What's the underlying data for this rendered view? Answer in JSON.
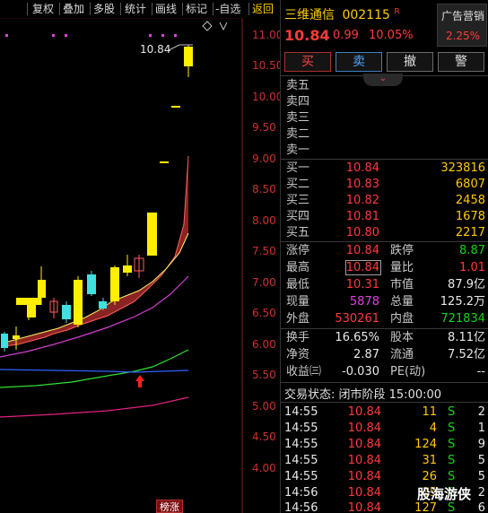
{
  "toolbar": {
    "items": [
      "复权",
      "叠加",
      "多股",
      "统计",
      "画线",
      "标记",
      "-自选"
    ],
    "back": "返回"
  },
  "chart": {
    "y_ticks": [
      "11.00",
      "10.50",
      "10.00",
      "9.50",
      "9.00",
      "8.50",
      "8.00",
      "7.50",
      "7.00",
      "6.50",
      "6.00",
      "5.50",
      "5.00",
      "4.50",
      "4.00"
    ],
    "last_price_label": "10.84",
    "tag": "榜涨",
    "up_arrow_icon": "up-arrow-icon"
  },
  "quote": {
    "name": "三维通信",
    "code": "002115",
    "margin_flag": "R",
    "price": "10.84",
    "change": "0.99",
    "change_pct": "10.05%",
    "ad_label": "广告营销",
    "ad_rate": "2.25%"
  },
  "buttons": {
    "buy": "买",
    "sell": "卖",
    "cancel": "撤",
    "alert": "警"
  },
  "ask": [
    {
      "label": "卖五"
    },
    {
      "label": "卖四"
    },
    {
      "label": "卖三"
    },
    {
      "label": "卖二"
    },
    {
      "label": "卖一"
    }
  ],
  "bid": [
    {
      "label": "买一",
      "price": "10.84",
      "vol": "323816"
    },
    {
      "label": "买二",
      "price": "10.83",
      "vol": "6807"
    },
    {
      "label": "买三",
      "price": "10.82",
      "vol": "2458"
    },
    {
      "label": "买四",
      "price": "10.81",
      "vol": "1678"
    },
    {
      "label": "买五",
      "price": "10.80",
      "vol": "2217"
    }
  ],
  "stats": {
    "limit_up_label": "涨停",
    "limit_up": "10.84",
    "limit_down_label": "跌停",
    "limit_down": "8.87",
    "high_label": "最高",
    "high": "10.84",
    "vol_ratio_label": "量比",
    "vol_ratio": "1.01",
    "low_label": "最低",
    "low": "10.31",
    "mkt_cap_label": "市值",
    "mkt_cap": "87.9亿",
    "last_vol_label": "现量",
    "last_vol": "5878",
    "total_vol_label": "总量",
    "total_vol": "125.2万",
    "outer_label": "外盘",
    "outer": "530261",
    "inner_label": "内盘",
    "inner": "721834",
    "turnover_label": "换手",
    "turnover": "16.65%",
    "shares_label": "股本",
    "shares": "8.11亿",
    "nav_label": "净资",
    "nav": "2.87",
    "float_label": "流通",
    "float": "7.52亿",
    "eps_label": "收益㈢",
    "eps": "-0.030",
    "pe_label": "PE(动)",
    "pe": "--"
  },
  "trade_status": "交易状态: 闭市阶段 15:00:00",
  "ticks": [
    {
      "time": "14:55",
      "price": "10.84",
      "vol": "11",
      "side": "S",
      "n": "2"
    },
    {
      "time": "14:55",
      "price": "10.84",
      "vol": "4",
      "side": "S",
      "n": "1"
    },
    {
      "time": "14:55",
      "price": "10.84",
      "vol": "124",
      "side": "S",
      "n": "9"
    },
    {
      "time": "14:55",
      "price": "10.84",
      "vol": "31",
      "side": "S",
      "n": "5"
    },
    {
      "time": "14:55",
      "price": "10.84",
      "vol": "26",
      "side": "S",
      "n": "5"
    },
    {
      "time": "14:56",
      "price": "10.84",
      "vol": "15",
      "side": "S",
      "n": "2"
    },
    {
      "time": "14:56",
      "price": "10.84",
      "vol": "127",
      "side": "S",
      "n": "6"
    }
  ],
  "watermark": "股海游侠",
  "colors": {
    "up": "#ff3b3b",
    "down": "#19d219",
    "bg": "#000000",
    "accent": "#ffcc00"
  }
}
